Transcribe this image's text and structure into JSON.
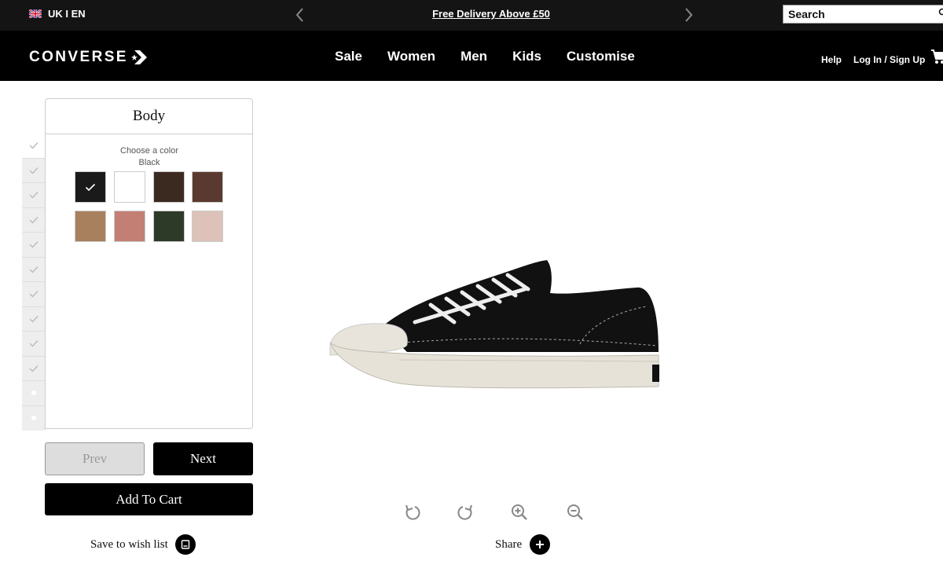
{
  "topbar": {
    "locale": "UK I EN",
    "promo": "Free Delivery Above £50",
    "search_value": "Search"
  },
  "navbar": {
    "logo": "CONVERSE",
    "links": [
      "Sale",
      "Women",
      "Men",
      "Kids",
      "Customise"
    ],
    "help": "Help",
    "login": "Log In / Sign Up"
  },
  "customizer": {
    "section_title": "Body",
    "choose_label": "Choose a color",
    "selected_color": "Black",
    "swatches": [
      "#1a1a1a",
      "#ffffff",
      "#3b2a20",
      "#5a3a30",
      "#a8805e",
      "#c47f74",
      "#2e3a28",
      "#dcc2b8"
    ],
    "prev_label": "Prev",
    "next_label": "Next",
    "add_to_cart_label": "Add To Cart",
    "wishlist_label": "Save to wish list"
  },
  "viewer": {
    "share_label": "Share"
  },
  "colors": {
    "accent": "#000000",
    "topbar_bg": "#141414"
  }
}
